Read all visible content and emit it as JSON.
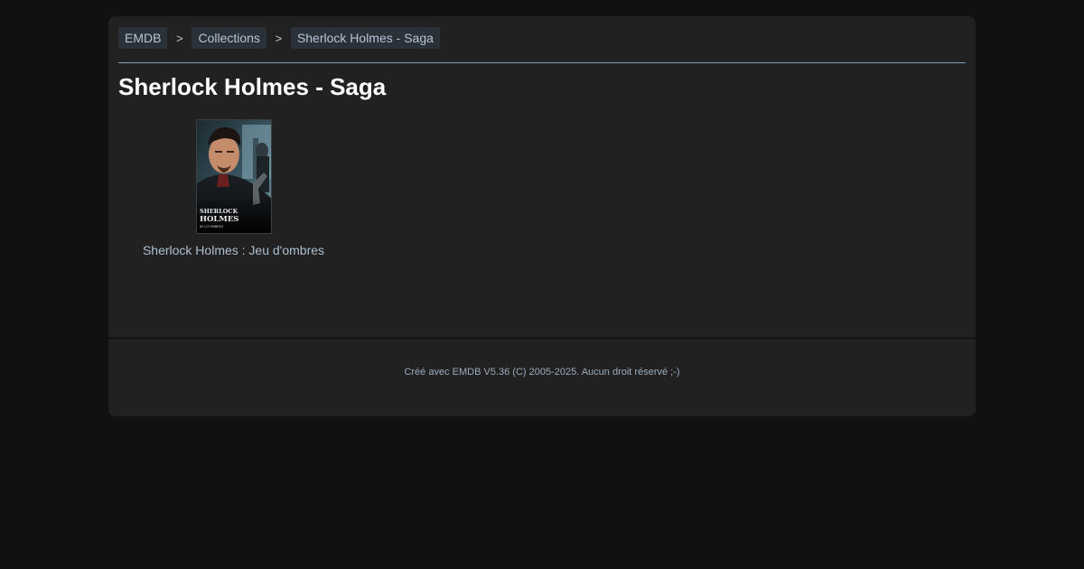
{
  "breadcrumb": {
    "items": [
      {
        "label": "EMDB"
      },
      {
        "label": "Collections"
      },
      {
        "label": "Sherlock Holmes - Saga"
      }
    ],
    "separator": ">"
  },
  "page": {
    "title": "Sherlock Holmes - Saga"
  },
  "movies": [
    {
      "title": "Sherlock Holmes : Jeu d'ombres",
      "poster": {
        "line1": "SHERLOCK",
        "line2": "HOLMES",
        "line3": "JEU D'OMBRES"
      }
    }
  ],
  "footer": {
    "text": "Créé avec EMDB V5.36 (C) 2005-2025. Aucun droit réservé ;-)"
  },
  "colors": {
    "page_background": "#111111",
    "panel_background": "#212121",
    "breadcrumb_background": "#2b3138",
    "link_text": "#b4c5d6",
    "title_text": "#ffffff"
  }
}
